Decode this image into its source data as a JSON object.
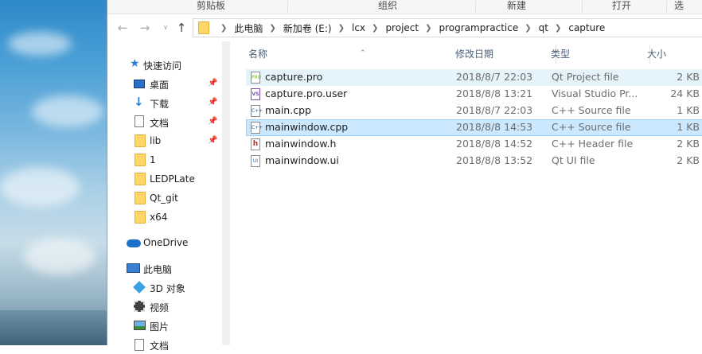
{
  "ribbon": {
    "groups": [
      "剪贴板",
      "组织",
      "新建",
      "打开",
      "选"
    ]
  },
  "nav": {
    "back_icon": "arrow-left-icon",
    "forward_icon": "arrow-right-icon",
    "dropdown_icon": "chevron-down-icon",
    "up_icon": "arrow-up-icon"
  },
  "breadcrumb": [
    "此电脑",
    "新加卷 (E:)",
    "lcx",
    "project",
    "programpractice",
    "qt",
    "capture"
  ],
  "sidebar": {
    "quick_access": "快速访问",
    "items": [
      {
        "label": "桌面",
        "icon": "desktop-icon",
        "pinned": true
      },
      {
        "label": "下载",
        "icon": "download-icon",
        "pinned": true
      },
      {
        "label": "文档",
        "icon": "document-icon",
        "pinned": true
      },
      {
        "label": "lib",
        "icon": "folder-icon",
        "pinned": true
      },
      {
        "label": "1",
        "icon": "folder-icon",
        "pinned": false
      },
      {
        "label": "LEDPLate",
        "icon": "folder-icon",
        "pinned": false
      },
      {
        "label": "Qt_git",
        "icon": "folder-icon",
        "pinned": false
      },
      {
        "label": "x64",
        "icon": "folder-icon",
        "pinned": false
      }
    ],
    "onedrive": "OneDrive",
    "this_pc": "此电脑",
    "pc_items": [
      {
        "label": "3D 对象",
        "icon": "3d-objects-icon"
      },
      {
        "label": "视频",
        "icon": "video-icon"
      },
      {
        "label": "图片",
        "icon": "pictures-icon"
      },
      {
        "label": "文档",
        "icon": "document-icon"
      }
    ]
  },
  "columns": {
    "name": "名称",
    "date": "修改日期",
    "type": "类型",
    "size": "大小"
  },
  "files": [
    {
      "name": "capture.pro",
      "date": "2018/8/7 22:03",
      "type": "Qt Project file",
      "size": "2 KB",
      "icon": "qt-project-file-icon",
      "state": "hover"
    },
    {
      "name": "capture.pro.user",
      "date": "2018/8/8 13:21",
      "type": "Visual Studio Pr...",
      "size": "24 KB",
      "icon": "visual-studio-file-icon",
      "state": ""
    },
    {
      "name": "main.cpp",
      "date": "2018/8/7 22:03",
      "type": "C++ Source file",
      "size": "1 KB",
      "icon": "cpp-file-icon",
      "state": ""
    },
    {
      "name": "mainwindow.cpp",
      "date": "2018/8/8 14:53",
      "type": "C++ Source file",
      "size": "1 KB",
      "icon": "cpp-file-icon",
      "state": "selected"
    },
    {
      "name": "mainwindow.h",
      "date": "2018/8/8 14:52",
      "type": "C++ Header file",
      "size": "2 KB",
      "icon": "header-file-icon",
      "state": ""
    },
    {
      "name": "mainwindow.ui",
      "date": "2018/8/8 13:52",
      "type": "Qt UI file",
      "size": "2 KB",
      "icon": "qt-ui-file-icon",
      "state": ""
    }
  ]
}
